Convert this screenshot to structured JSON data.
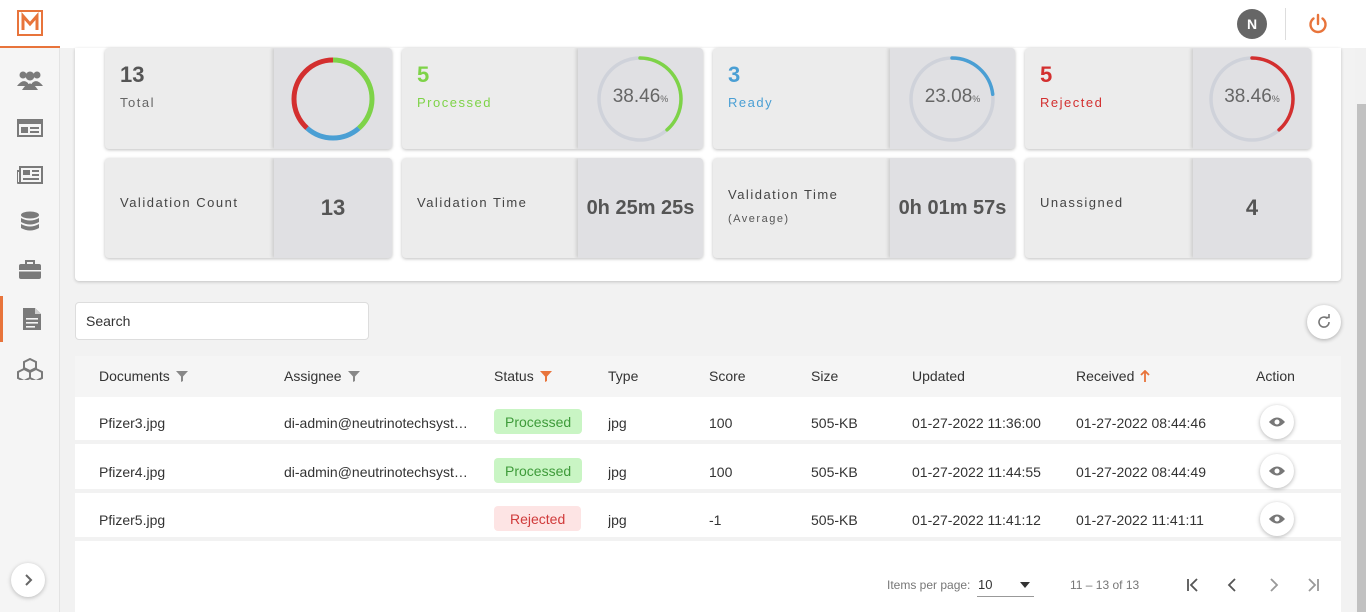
{
  "header": {
    "avatar_initial": "N",
    "power_icon": "power-icon"
  },
  "sidebar": {
    "logo": "N",
    "items": [
      {
        "icon": "users-icon"
      },
      {
        "icon": "id-card-icon"
      },
      {
        "icon": "newspaper-icon"
      },
      {
        "icon": "database-icon"
      },
      {
        "icon": "briefcase-icon"
      },
      {
        "icon": "document-icon",
        "active": true
      },
      {
        "icon": "cubes-icon"
      }
    ]
  },
  "stats": {
    "total": {
      "value": "13",
      "label": "Total"
    },
    "processed": {
      "value": "5",
      "label": "Processed",
      "percent": "38.46",
      "unit": "%",
      "color": "#7ed348"
    },
    "ready": {
      "value": "3",
      "label": "Ready",
      "percent": "23.08",
      "unit": "%",
      "color": "#4a9fd4"
    },
    "rejected": {
      "value": "5",
      "label": "Rejected",
      "percent": "38.46",
      "unit": "%",
      "color": "#d32f2f"
    },
    "validation_count": {
      "label": "Validation Count",
      "value": "13"
    },
    "validation_time": {
      "label": "Validation Time",
      "value": "0h 25m 25s"
    },
    "validation_time_avg": {
      "label": "Validation Time",
      "sublabel": "(Average)",
      "value": "0h 01m 57s"
    },
    "unassigned": {
      "label": "Unassigned",
      "value": "4"
    }
  },
  "search": {
    "placeholder": "Search"
  },
  "table": {
    "columns": {
      "documents": "Documents",
      "assignee": "Assignee",
      "status": "Status",
      "type": "Type",
      "score": "Score",
      "size": "Size",
      "updated": "Updated",
      "received": "Received",
      "action": "Action"
    },
    "rows": [
      {
        "document": "Pfizer3.jpg",
        "assignee": "di-admin@neutrinotechsyst…",
        "status": "Processed",
        "type": "jpg",
        "score": "100",
        "size": "505-KB",
        "updated": "01-27-2022 11:36:00",
        "received": "01-27-2022 08:44:46"
      },
      {
        "document": "Pfizer4.jpg",
        "assignee": "di-admin@neutrinotechsyst…",
        "status": "Processed",
        "type": "jpg",
        "score": "100",
        "size": "505-KB",
        "updated": "01-27-2022 11:44:55",
        "received": "01-27-2022 08:44:49"
      },
      {
        "document": "Pfizer5.jpg",
        "assignee": "",
        "status": "Rejected",
        "type": "jpg",
        "score": "-1",
        "size": "505-KB",
        "updated": "01-27-2022 11:41:12",
        "received": "01-27-2022 11:41:11"
      }
    ]
  },
  "paginator": {
    "items_per_page_label": "Items per page:",
    "items_per_page": "10",
    "range": "11 – 13 of 13"
  },
  "colors": {
    "accent": "#e8743b",
    "processed": "#7ed348",
    "ready": "#4a9fd4",
    "rejected": "#d32f2f"
  }
}
